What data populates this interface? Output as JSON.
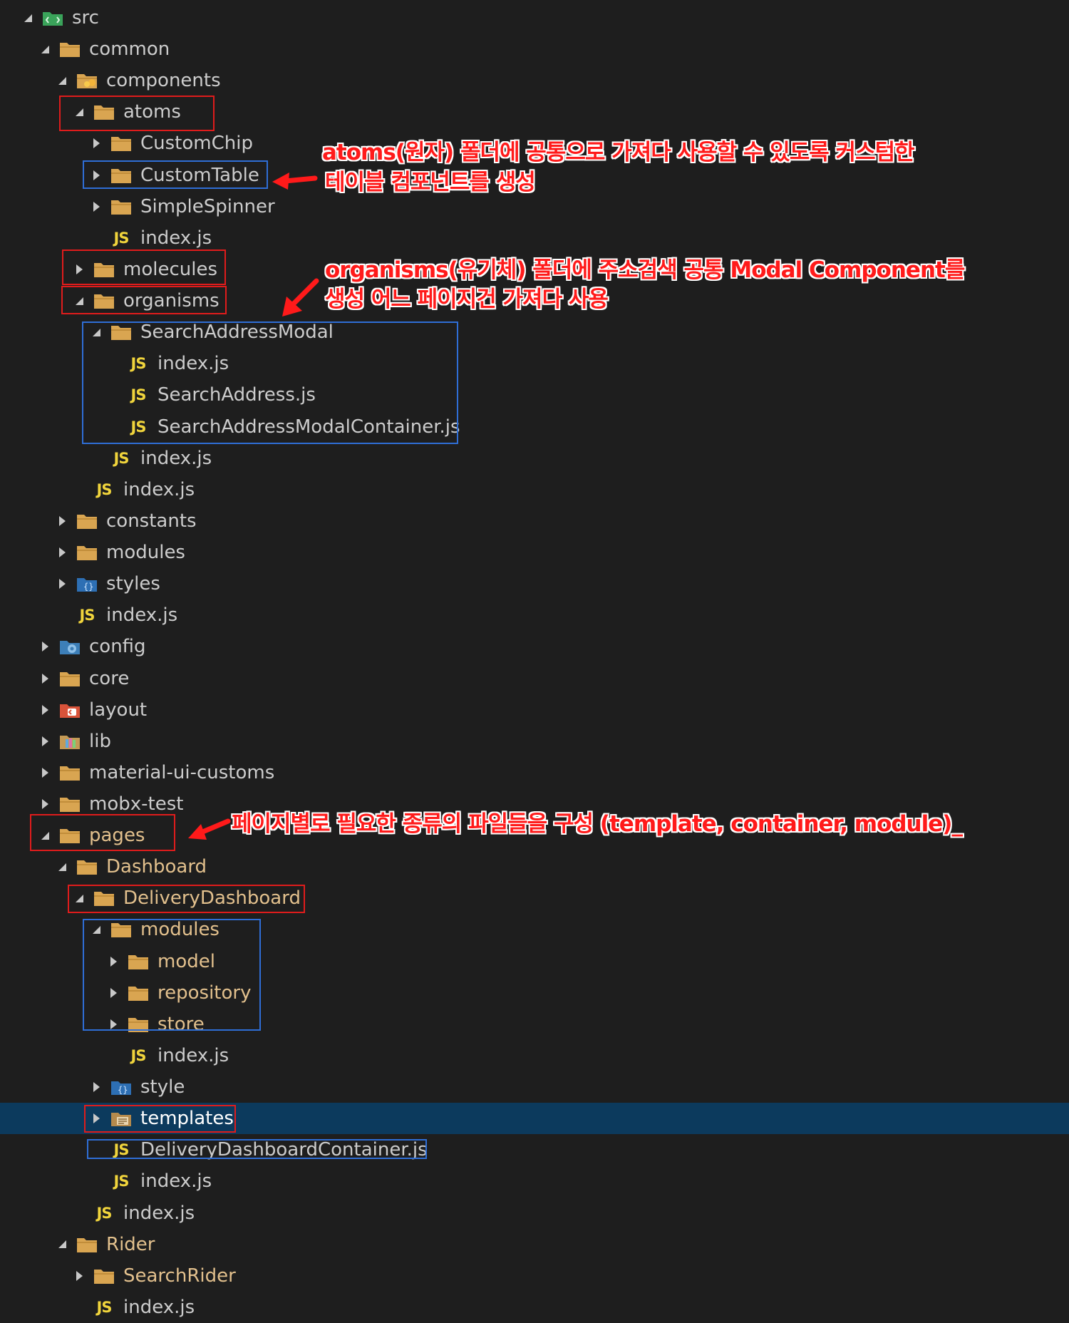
{
  "colors": {
    "background": "#1e1e1e",
    "selection": "#0c3a5d",
    "text": "#cccccc",
    "modified_text": "#e2c08d",
    "folder": "#d9a551",
    "js": "#f0d43c",
    "highlight_red": "#e01c1c",
    "highlight_blue": "#2f6ed6",
    "annotation": "#ff1a1a"
  },
  "tree": [
    {
      "name": "src",
      "level": 0,
      "type": "folder",
      "expanded": true,
      "icon": "src-folder-icon"
    },
    {
      "name": "common",
      "level": 1,
      "type": "folder",
      "expanded": true,
      "icon": "folder-icon"
    },
    {
      "name": "components",
      "level": 2,
      "type": "folder",
      "expanded": true,
      "icon": "components-folder-icon"
    },
    {
      "name": "atoms",
      "level": 3,
      "type": "folder",
      "expanded": true,
      "icon": "folder-icon"
    },
    {
      "name": "CustomChip",
      "level": 4,
      "type": "folder",
      "expanded": false,
      "icon": "folder-icon"
    },
    {
      "name": "CustomTable",
      "level": 4,
      "type": "folder",
      "expanded": false,
      "icon": "folder-icon"
    },
    {
      "name": "SimpleSpinner",
      "level": 4,
      "type": "folder",
      "expanded": false,
      "icon": "folder-icon"
    },
    {
      "name": "index.js",
      "level": 4,
      "type": "js",
      "icon": "js-file-icon"
    },
    {
      "name": "molecules",
      "level": 3,
      "type": "folder",
      "expanded": false,
      "icon": "folder-icon"
    },
    {
      "name": "organisms",
      "level": 3,
      "type": "folder",
      "expanded": true,
      "icon": "folder-icon"
    },
    {
      "name": "SearchAddressModal",
      "level": 4,
      "type": "folder",
      "expanded": true,
      "icon": "folder-icon"
    },
    {
      "name": "index.js",
      "level": 5,
      "type": "js",
      "icon": "js-file-icon"
    },
    {
      "name": "SearchAddress.js",
      "level": 5,
      "type": "js",
      "icon": "js-file-icon"
    },
    {
      "name": "SearchAddressModalContainer.js",
      "level": 5,
      "type": "js",
      "icon": "js-file-icon"
    },
    {
      "name": "index.js",
      "level": 4,
      "type": "js",
      "icon": "js-file-icon"
    },
    {
      "name": "index.js",
      "level": 3,
      "type": "js",
      "icon": "js-file-icon"
    },
    {
      "name": "constants",
      "level": 2,
      "type": "folder",
      "expanded": false,
      "icon": "folder-icon"
    },
    {
      "name": "modules",
      "level": 2,
      "type": "folder",
      "expanded": false,
      "icon": "folder-icon"
    },
    {
      "name": "styles",
      "level": 2,
      "type": "folder",
      "expanded": false,
      "icon": "styles-folder-icon"
    },
    {
      "name": "index.js",
      "level": 2,
      "type": "js",
      "icon": "js-file-icon"
    },
    {
      "name": "config",
      "level": 1,
      "type": "folder",
      "expanded": false,
      "icon": "config-folder-icon"
    },
    {
      "name": "core",
      "level": 1,
      "type": "folder",
      "expanded": false,
      "icon": "folder-icon"
    },
    {
      "name": "layout",
      "level": 1,
      "type": "folder",
      "expanded": false,
      "icon": "layout-folder-icon"
    },
    {
      "name": "lib",
      "level": 1,
      "type": "folder",
      "expanded": false,
      "icon": "lib-folder-icon"
    },
    {
      "name": "material-ui-customs",
      "level": 1,
      "type": "folder",
      "expanded": false,
      "icon": "folder-icon"
    },
    {
      "name": "mobx-test",
      "level": 1,
      "type": "folder",
      "expanded": false,
      "icon": "folder-icon"
    },
    {
      "name": "pages",
      "level": 1,
      "type": "folder",
      "expanded": true,
      "icon": "folder-icon",
      "modified": true
    },
    {
      "name": "Dashboard",
      "level": 2,
      "type": "folder",
      "expanded": true,
      "icon": "folder-icon",
      "modified": true
    },
    {
      "name": "DeliveryDashboard",
      "level": 3,
      "type": "folder",
      "expanded": true,
      "icon": "folder-icon",
      "modified": true
    },
    {
      "name": "modules",
      "level": 4,
      "type": "folder",
      "expanded": true,
      "icon": "folder-icon",
      "modified": true
    },
    {
      "name": "model",
      "level": 5,
      "type": "folder",
      "expanded": false,
      "icon": "folder-icon",
      "modified": true
    },
    {
      "name": "repository",
      "level": 5,
      "type": "folder",
      "expanded": false,
      "icon": "folder-icon",
      "modified": true
    },
    {
      "name": "store",
      "level": 5,
      "type": "folder",
      "expanded": false,
      "icon": "folder-icon",
      "modified": true
    },
    {
      "name": "index.js",
      "level": 5,
      "type": "js",
      "icon": "js-file-icon"
    },
    {
      "name": "style",
      "level": 4,
      "type": "folder",
      "expanded": false,
      "icon": "styles-folder-icon"
    },
    {
      "name": "templates",
      "level": 4,
      "type": "folder",
      "expanded": false,
      "icon": "templates-folder-icon",
      "selected": true
    },
    {
      "name": "DeliveryDashboardContainer.js",
      "level": 4,
      "type": "js",
      "icon": "js-file-icon"
    },
    {
      "name": "index.js",
      "level": 4,
      "type": "js",
      "icon": "js-file-icon"
    },
    {
      "name": "index.js",
      "level": 3,
      "type": "js",
      "icon": "js-file-icon"
    },
    {
      "name": "Rider",
      "level": 2,
      "type": "folder",
      "expanded": true,
      "icon": "folder-icon",
      "modified": true
    },
    {
      "name": "SearchRider",
      "level": 3,
      "type": "folder",
      "expanded": false,
      "icon": "folder-icon",
      "modified": true
    },
    {
      "name": "index.js",
      "level": 3,
      "type": "js",
      "icon": "js-file-icon"
    }
  ],
  "js_label": "JS",
  "annotations": {
    "atoms_line1": "atoms(원자) 폴더에 공통으로 가져다 사용할 수 있도록 커스텀한",
    "atoms_line2": "테이블 컴포넌트를 생성",
    "organisms_line1": "organisms(유기체)  폴더에 주소검색 공통  Modal  Component를",
    "organisms_line2": "생성 어느 페이지건 가져다 사용",
    "pages_line1": "페이지별로 필요한 종류의  파일들을 구성 (template,  container,  module)_"
  }
}
